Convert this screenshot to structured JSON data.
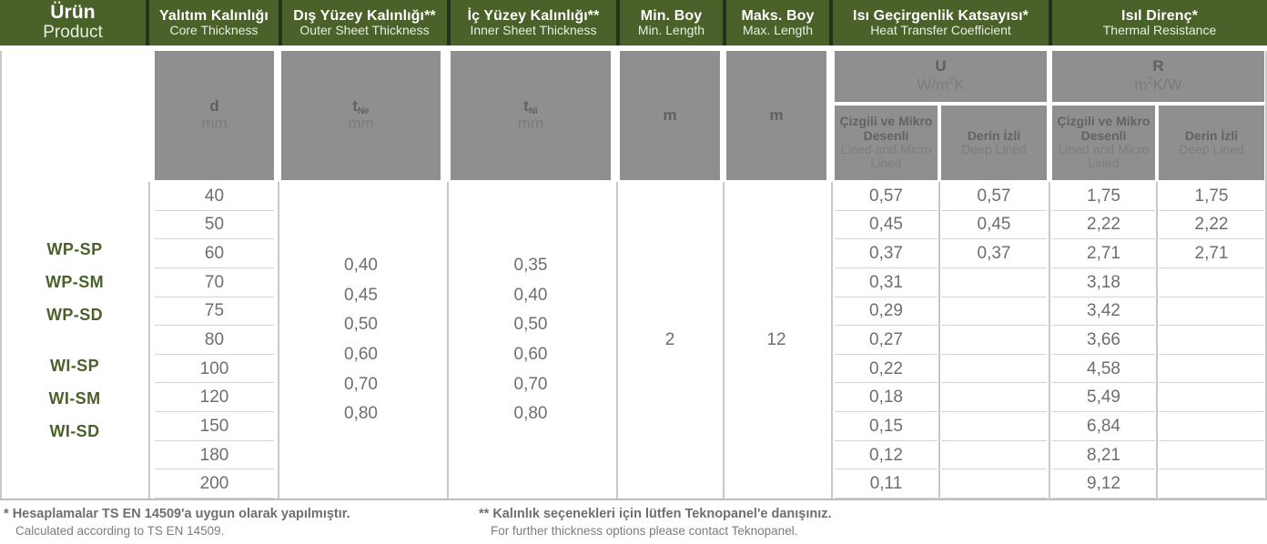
{
  "table": {
    "headers": [
      {
        "tr": "Ürün",
        "en": "Product"
      },
      {
        "tr": "Yalıtım Kalınlığı",
        "en": "Core Thickness"
      },
      {
        "tr": "Dış Yüzey Kalınlığı**",
        "en": "Outer Sheet Thickness"
      },
      {
        "tr": "İç Yüzey Kalınlığı**",
        "en": "Inner Sheet Thickness"
      },
      {
        "tr": "Min. Boy",
        "en": "Min. Length"
      },
      {
        "tr": "Maks. Boy",
        "en": "Max. Length"
      },
      {
        "tr": "Isı Geçirgenlik Katsayısı*",
        "en": "Heat Transfer Coefficient"
      },
      {
        "tr": "Isıl Direnç*",
        "en": "Thermal Resistance"
      }
    ],
    "subheaders": {
      "core_symbol": "d",
      "core_sub": "",
      "core_unit": "mm",
      "outer_symbol": "t",
      "outer_sub": "Ne",
      "outer_unit": "mm",
      "inner_symbol": "t",
      "inner_sub": "Ni",
      "inner_unit": "mm",
      "min_length_unit": "m",
      "max_length_unit": "m",
      "u_symbol": "U",
      "u_unit_pre": "W/m",
      "u_unit_sup": "2",
      "u_unit_post": "K",
      "r_symbol": "R",
      "r_unit_pre": "m",
      "r_unit_sup": "2",
      "r_unit_post": "K/W",
      "lined_tr": "Çizgili ve Mikro Desenli",
      "lined_en": "Lined and Micro Lined",
      "deep_tr": "Derin İzli",
      "deep_en": "Deep Lined"
    },
    "products_group_1": [
      "WP-SP",
      "WP-SM",
      "WP-SD"
    ],
    "products_group_2": [
      "WI-SP",
      "WI-SM",
      "WI-SD"
    ],
    "core_thickness": [
      "40",
      "50",
      "60",
      "70",
      "75",
      "80",
      "100",
      "120",
      "150",
      "180",
      "200"
    ],
    "outer_sheet_thickness": [
      "0,40",
      "0,45",
      "0,50",
      "0,60",
      "0,70",
      "0,80"
    ],
    "inner_sheet_thickness": [
      "0,35",
      "0,40",
      "0,50",
      "0,60",
      "0,70",
      "0,80"
    ],
    "min_length": "2",
    "max_length": "12",
    "u_lined": [
      "0,57",
      "0,45",
      "0,37",
      "0,31",
      "0,29",
      "0,27",
      "0,22",
      "0,18",
      "0,15",
      "0,12",
      "0,11"
    ],
    "u_deep": [
      "0,57",
      "0,45",
      "0,37",
      "",
      "",
      "",
      "",
      "",
      "",
      "",
      ""
    ],
    "r_lined": [
      "1,75",
      "2,22",
      "2,71",
      "3,18",
      "3,42",
      "3,66",
      "4,58",
      "5,49",
      "6,84",
      "8,21",
      "9,12"
    ],
    "r_deep": [
      "1,75",
      "2,22",
      "2,71",
      "",
      "",
      "",
      "",
      "",
      "",
      "",
      ""
    ]
  },
  "footnotes": [
    {
      "marker": "*",
      "tr": "Hesaplamalar TS EN 14509'a uygun olarak yapılmıştır.",
      "en": "Calculated according to TS EN 14509."
    },
    {
      "marker": "**",
      "tr": "Kalınlık seçenekleri için lütfen Teknopanel'e danışınız.",
      "en": "For further thickness options please contact Teknopanel."
    }
  ],
  "colors": {
    "header_green": "#4a6129",
    "subheader_gray": "#8f8f8f",
    "product_green": "#4a6129",
    "body_text": "#6e6e6e"
  }
}
